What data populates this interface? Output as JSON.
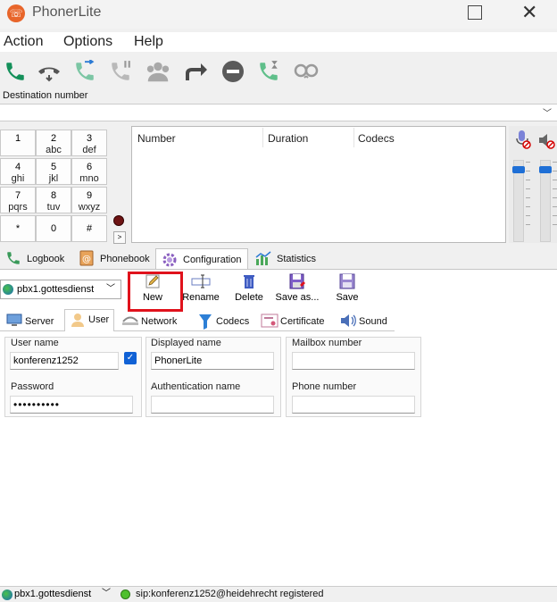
{
  "window": {
    "title": "PhonerLite",
    "app_icon_glyph": "☏"
  },
  "menu": {
    "items": [
      "Action",
      "Options",
      "Help"
    ]
  },
  "toolbar": {
    "icons": [
      "phone-call-icon",
      "hang-up-icon",
      "transfer-icon",
      "hold-icon",
      "conference-icon",
      "forward-icon",
      "do-not-disturb-icon",
      "call-waiting-icon",
      "anonymous-icon"
    ]
  },
  "destination": {
    "label": "Destination number",
    "value": ""
  },
  "keypad": {
    "keys": [
      {
        "digit": "1",
        "letters": ""
      },
      {
        "digit": "2",
        "letters": "abc"
      },
      {
        "digit": "3",
        "letters": "def"
      },
      {
        "digit": "4",
        "letters": "ghi"
      },
      {
        "digit": "5",
        "letters": "jkl"
      },
      {
        "digit": "6",
        "letters": "mno"
      },
      {
        "digit": "7",
        "letters": "pqrs"
      },
      {
        "digit": "8",
        "letters": "tuv"
      },
      {
        "digit": "9",
        "letters": "wxyz"
      },
      {
        "digit": "*",
        "letters": ""
      },
      {
        "digit": "0",
        "letters": ""
      },
      {
        "digit": "#",
        "letters": ""
      }
    ],
    "small_key_label": ">"
  },
  "call_list": {
    "columns": [
      "Number",
      "Duration",
      "Codecs"
    ]
  },
  "volume": {
    "mic_level": 0.9,
    "speaker_level": 0.9
  },
  "main_tabs": [
    {
      "label": "Logbook",
      "icon": "logbook-icon"
    },
    {
      "label": "Phonebook",
      "icon": "phonebook-icon"
    },
    {
      "label": "Configuration",
      "icon": "configuration-icon",
      "active": true
    },
    {
      "label": "Statistics",
      "icon": "statistics-icon"
    }
  ],
  "config": {
    "profile": "pbx1.gottesdienst",
    "buttons": [
      {
        "label": "New",
        "icon": "pencil-icon"
      },
      {
        "label": "Rename",
        "icon": "rename-icon"
      },
      {
        "label": "Delete",
        "icon": "trash-icon"
      },
      {
        "label": "Save as...",
        "icon": "save-as-icon"
      },
      {
        "label": "Save",
        "icon": "save-icon"
      }
    ],
    "sub_tabs": [
      {
        "label": "Server",
        "icon": "server-icon"
      },
      {
        "label": "User",
        "icon": "user-icon",
        "active": true
      },
      {
        "label": "Network",
        "icon": "network-icon"
      },
      {
        "label": "Codecs",
        "icon": "codecs-icon"
      },
      {
        "label": "Certificate",
        "icon": "certificate-icon"
      },
      {
        "label": "Sound",
        "icon": "sound-icon"
      }
    ],
    "fields": {
      "user_name": {
        "label": "User name",
        "value": "konferenz1252"
      },
      "password": {
        "label": "Password",
        "value": "••••••••••"
      },
      "displayed_name": {
        "label": "Displayed name",
        "value": "PhonerLite"
      },
      "authentication_name": {
        "label": "Authentication name",
        "value": ""
      },
      "mailbox_number": {
        "label": "Mailbox number",
        "value": ""
      },
      "phone_number": {
        "label": "Phone number",
        "value": ""
      }
    }
  },
  "status": {
    "profile": "pbx1.gottesdienst",
    "text": "sip:konferenz1252@heidehrecht registered",
    "led_color": "#4fc02e"
  },
  "colors": {
    "accent": "#1061d5",
    "highlight": "#e0121c"
  }
}
